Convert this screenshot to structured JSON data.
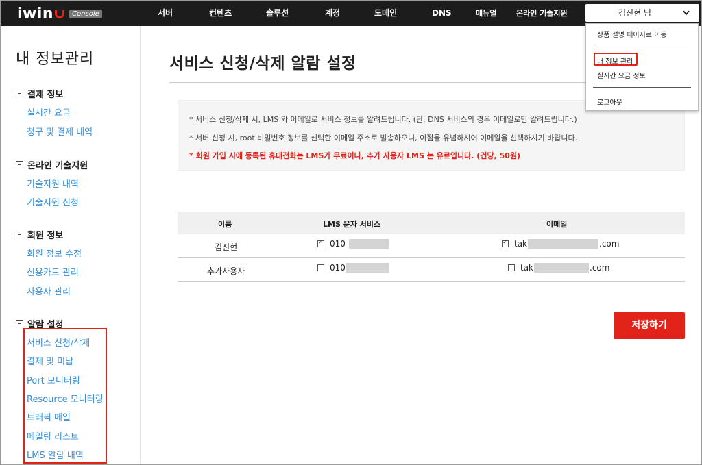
{
  "header": {
    "logo_text": "iwin",
    "console_badge": "Console",
    "nav": [
      "서버",
      "컨텐츠",
      "솔루션",
      "계정",
      "도메인",
      "DNS",
      "매뉴얼",
      "온라인 기술지원"
    ],
    "user_name": "김진현 님"
  },
  "dropdown": {
    "items": [
      "상품 설명 페이지로 이동",
      "내 정보 관리",
      "실시간 요금 정보",
      "로그아웃"
    ]
  },
  "sidebar": {
    "title": "내 정보관리",
    "sections": [
      {
        "label": "결제 정보",
        "links": [
          "실시간 요금",
          "청구 및 결제 내역"
        ]
      },
      {
        "label": "온라인 기술지원",
        "links": [
          "기술지원 내역",
          "기술지원 신청"
        ]
      },
      {
        "label": "회원 정보",
        "links": [
          "회원 정보 수정",
          "신용카드 관리",
          "사용자 관리"
        ]
      },
      {
        "label": "알람 설정",
        "links": [
          "서비스 신청/삭제",
          "결제 및 미납",
          "Port 모니터링",
          "Resource 모니터링",
          "트래픽 메일",
          "메일링 리스트",
          "LMS 알람 내역"
        ]
      }
    ]
  },
  "main": {
    "title": "서비스 신청/삭제 알람 설정",
    "notices": [
      "* 서비스 신청/삭제 시, LMS 와 이메일로 서비스 정보를 알려드립니다. (단, DNS 서비스의 경우 이메일로만 알려드립니다.)",
      "* 서버 신청 시, root 비밀번호 정보를 선택한 이메일 주소로 발송하오니, 이점을 유념하시어 이메일을 선택하시기 바랍니다.",
      "* 회원 가입 시에 등록된 휴대전화는 LMS가 무료이나, 추가 사용자 LMS 는 유료입니다. (건당, 50원)"
    ],
    "table": {
      "headers": [
        "이름",
        "LMS 문자 서비스",
        "이메일"
      ],
      "rows": [
        {
          "name": "김진현",
          "lms_checked": true,
          "phone": "010-",
          "email_checked": true,
          "email_prefix": "tak",
          "email_suffix": ".com"
        },
        {
          "name": "추가사용자",
          "lms_checked": false,
          "phone": "010",
          "email_checked": false,
          "email_prefix": "tak",
          "email_suffix": ".com"
        }
      ]
    },
    "save_label": "저장하기"
  }
}
